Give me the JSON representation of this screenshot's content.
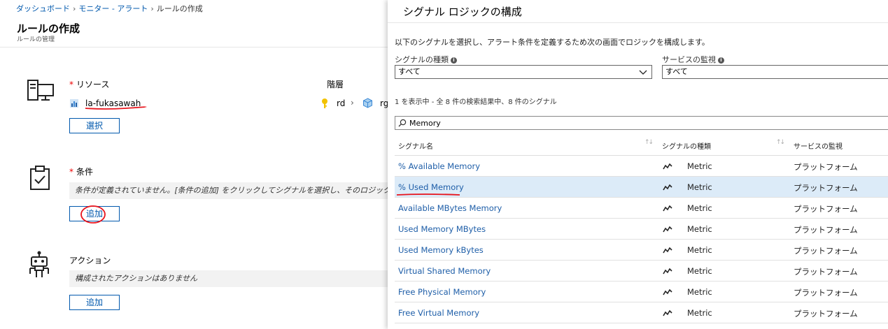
{
  "breadcrumb": [
    "ダッシュボード",
    "モニター - アラート",
    "ルールの作成"
  ],
  "left": {
    "title": "ルールの作成",
    "subtitle": "ルールの管理",
    "resource": {
      "label": "リソース",
      "hierarchy_label": "階層",
      "name": "la-fukasawah",
      "hier_items": [
        "rd",
        "rg"
      ],
      "select_button": "選択"
    },
    "condition": {
      "label": "条件",
      "note": "条件が定義されていません。[条件の追加] をクリックしてシグナルを選択し、そのロジックを定義します。",
      "add_button": "追加"
    },
    "action": {
      "label": "アクション",
      "note": "構成されたアクションはありません",
      "add_button": "追加"
    }
  },
  "panel": {
    "title": "シグナル ロジックの構成",
    "description": "以下のシグナルを選択し、アラート条件を定義するため次の画面でロジックを構成します。",
    "signal_type_label": "シグナルの種類",
    "signal_type_value": "すべて",
    "service_label": "サービスの監視",
    "service_value": "すべて",
    "results_text": "1 を表示中 - 全 8 件の検索結果中、8 件のシグナル",
    "search_value": "Memory",
    "columns": [
      "シグナル名",
      "シグナルの種類",
      "サービスの監視"
    ],
    "rows": [
      {
        "name": "% Available Memory",
        "type": "Metric",
        "service": "プラットフォーム"
      },
      {
        "name": "% Used Memory",
        "type": "Metric",
        "service": "プラットフォーム"
      },
      {
        "name": "Available MBytes Memory",
        "type": "Metric",
        "service": "プラットフォーム"
      },
      {
        "name": "Used Memory MBytes",
        "type": "Metric",
        "service": "プラットフォーム"
      },
      {
        "name": "Used Memory kBytes",
        "type": "Metric",
        "service": "プラットフォーム"
      },
      {
        "name": "Virtual Shared Memory",
        "type": "Metric",
        "service": "プラットフォーム"
      },
      {
        "name": "Free Physical Memory",
        "type": "Metric",
        "service": "プラットフォーム"
      },
      {
        "name": "Free Virtual Memory",
        "type": "Metric",
        "service": "プラットフォーム"
      }
    ],
    "selected_row": 1
  },
  "colors": {
    "link": "#0058ad",
    "signal_name": "#1e5ea8",
    "selected_row": "#dcebf8",
    "annotation": "#e8141c"
  }
}
